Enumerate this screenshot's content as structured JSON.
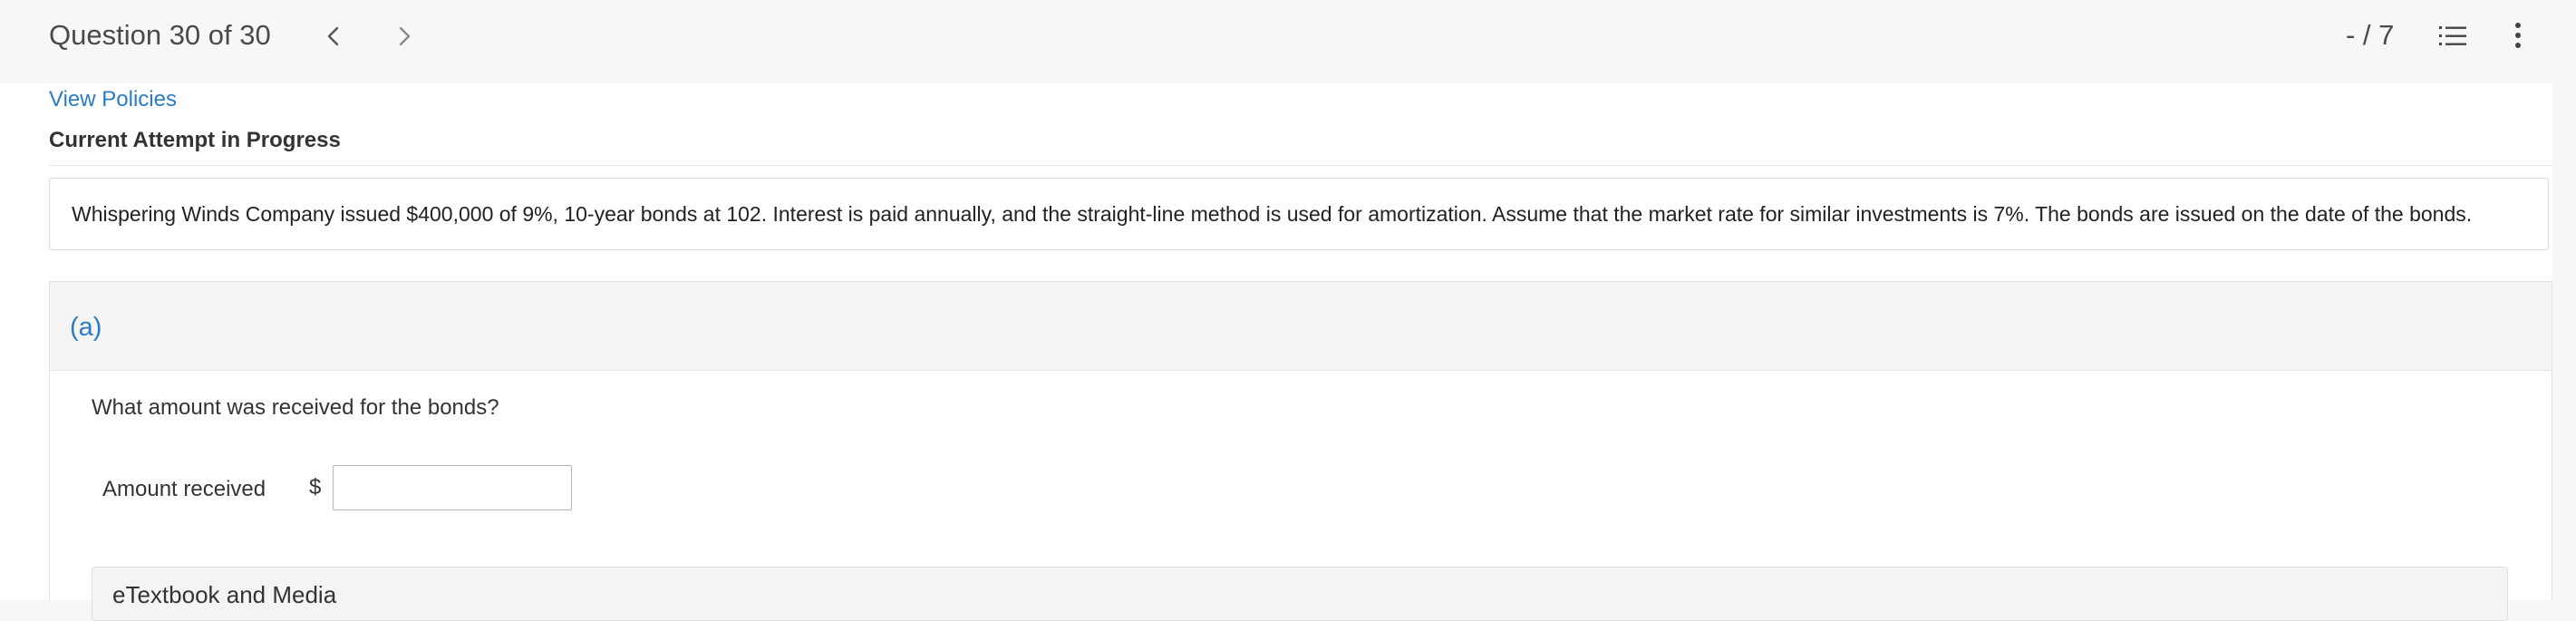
{
  "header": {
    "question_counter": "Question 30 of 30",
    "score": "- / 7",
    "icons": {
      "prev": "chevron-left-icon",
      "next": "chevron-right-icon",
      "list": "numbered-list-icon",
      "more": "more-vertical-icon"
    }
  },
  "policies_link": "View Policies",
  "attempt_status": "Current Attempt in Progress",
  "question": {
    "text": "Whispering Winds Company issued $400,000 of 9%, 10-year bonds at 102. Interest is paid annually, and the straight-line method is used for amortization. Assume that the market rate for similar investments is 7%. The bonds are issued on the date of the bonds."
  },
  "part_a": {
    "label": "(a)",
    "prompt": "What amount was received for the bonds?",
    "amount_label": "Amount received",
    "currency_symbol": "$",
    "amount_value": "",
    "etext_label": "eTextbook and Media"
  },
  "colors": {
    "link": "#2b7bc3",
    "background": "#f7f7f7",
    "panel": "#ffffff"
  }
}
